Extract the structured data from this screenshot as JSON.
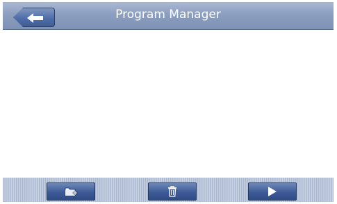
{
  "header": {
    "title": "Program Manager"
  },
  "icons": {
    "back": "arrow-left-icon",
    "new_folder": "folder-add-icon",
    "delete": "trash-icon",
    "run": "play-icon"
  },
  "colors": {
    "title_bar": "#8c9fc0",
    "button": "#3d5b98",
    "toolbar": "#b6c3d9",
    "title_text": "#ffffff"
  }
}
